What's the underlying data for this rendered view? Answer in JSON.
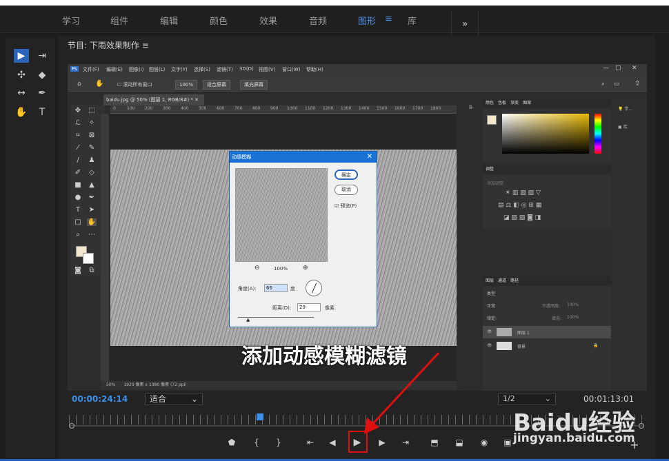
{
  "workspace_tabs": [
    {
      "label": "学习",
      "active": false
    },
    {
      "label": "组件",
      "active": false
    },
    {
      "label": "编辑",
      "active": false
    },
    {
      "label": "颜色",
      "active": false
    },
    {
      "label": "效果",
      "active": false
    },
    {
      "label": "音频",
      "active": false
    },
    {
      "label": "图形",
      "active": true
    },
    {
      "label": "库",
      "active": false
    }
  ],
  "workspace_more": "»",
  "workspace_menu_icon": "≡",
  "program_monitor": {
    "title": "节目: 下雨效果制作",
    "menu_icon": "≡"
  },
  "photoshop": {
    "menu": [
      "文件(F)",
      "编辑(E)",
      "图像(I)",
      "图层(L)",
      "文字(Y)",
      "选择(S)",
      "滤镜(T)",
      "3D(D)",
      "视图(V)",
      "窗口(W)",
      "帮助(H)"
    ],
    "options": {
      "scroll_all": "滚动所有窗口",
      "zoom": "100%",
      "fit_screen": "适合屏幕",
      "fill_screen": "填充屏幕"
    },
    "doc_tab": "baidu.jpg @ 50% (图层 1, RGB/8#) *",
    "ruler_marks": [
      "0",
      "100",
      "200",
      "300",
      "400",
      "500",
      "600",
      "700",
      "800",
      "900",
      "1000",
      "1100",
      "1200",
      "1300",
      "1400",
      "1500",
      "1600",
      "1700",
      "1800"
    ],
    "status": {
      "zoom": "50%",
      "info": "1920 像素 x 1080 像素 (72 ppi)"
    },
    "dialog": {
      "title": "动感模糊",
      "ok": "确定",
      "cancel": "取消",
      "preview": "预览(P)",
      "zoom": "100%",
      "angle_label": "角度(A):",
      "angle_value": "66",
      "angle_unit": "度",
      "distance_label": "距离(D):",
      "distance_value": "29",
      "distance_unit": "像素"
    },
    "color_panel": {
      "tabs": [
        "颜色",
        "色板",
        "渐变",
        "图案"
      ]
    },
    "adjust_panel": {
      "title": "调整",
      "add": "添加调整"
    },
    "layers_panel": {
      "tabs": [
        "图层",
        "通道",
        "路径"
      ],
      "kind": "类型",
      "blend": "正常",
      "opacity_label": "不透明度:",
      "opacity_value": "100%",
      "lock_label": "锁定:",
      "fill_label": "填充:",
      "fill_value": "100%",
      "layers": [
        {
          "name": "图层 1"
        },
        {
          "name": "背景"
        }
      ]
    },
    "side_panel": {
      "learn": "学...",
      "library": "库"
    }
  },
  "annotation": "添加动感模糊滤镜",
  "timeline": {
    "current": "00:00:24:14",
    "fit": "适合",
    "ratio": "1/2",
    "end": "00:01:13:01"
  },
  "watermark": {
    "brand": "Baidu经验",
    "url": "jingyan.baidu.com"
  }
}
